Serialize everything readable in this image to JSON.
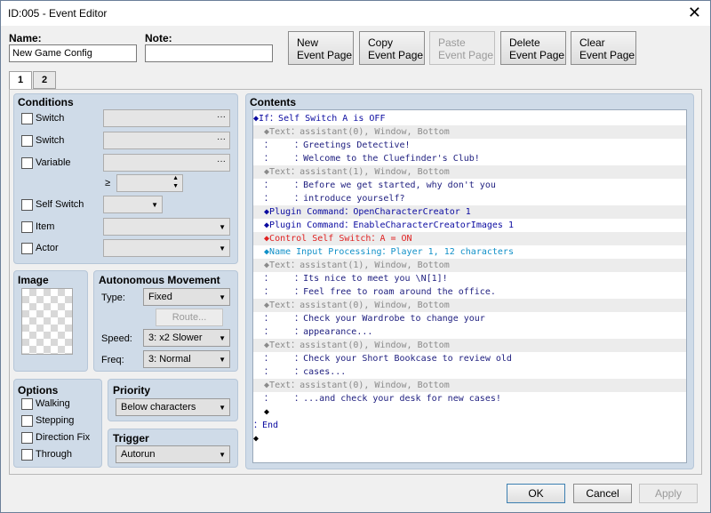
{
  "window": {
    "title": "ID:005 - Event Editor",
    "close": "✕"
  },
  "name_label": "Name:",
  "name_value": "New Game Config",
  "note_label": "Note:",
  "note_value": "",
  "page_buttons": {
    "new": [
      "New",
      "Event Page"
    ],
    "copy": [
      "Copy",
      "Event Page"
    ],
    "paste": [
      "Paste",
      "Event Page"
    ],
    "delete": [
      "Delete",
      "Event Page"
    ],
    "clear": [
      "Clear",
      "Event Page"
    ]
  },
  "tabs": [
    "1",
    "2"
  ],
  "conditions": {
    "title": "Conditions",
    "switch1": "Switch",
    "switch2": "Switch",
    "variable": "Variable",
    "ge": "≥",
    "self_switch": "Self Switch",
    "item": "Item",
    "actor": "Actor",
    "dots": "···"
  },
  "image": {
    "title": "Image"
  },
  "autonomous": {
    "title": "Autonomous Movement",
    "type_label": "Type:",
    "type_value": "Fixed",
    "route_button": "Route...",
    "speed_label": "Speed:",
    "speed_value": "3: x2 Slower",
    "freq_label": "Freq:",
    "freq_value": "3: Normal"
  },
  "options": {
    "title": "Options",
    "walking": "Walking",
    "stepping": "Stepping",
    "direction_fix": "Direction Fix",
    "through": "Through"
  },
  "priority": {
    "title": "Priority",
    "value": "Below characters"
  },
  "trigger": {
    "title": "Trigger",
    "value": "Autorun"
  },
  "contents": {
    "title": "Contents",
    "lines": [
      "◆If：Self Switch A is OFF",
      "  ◆Text：assistant(0), Window, Bottom",
      "  ：    ：Greetings Detective!",
      "  ：    ：Welcome to the Cluefinder's Club!",
      "  ◆Text：assistant(1), Window, Bottom",
      "  ：    ：Before we get started, why don't you",
      "  ：    ：introduce yourself?",
      "  ◆Plugin Command：OpenCharacterCreator 1",
      "  ◆Plugin Command：EnableCharacterCreatorImages 1",
      "  ◆Control Self Switch：A = ON",
      "  ◆Name Input Processing：Player 1, 12 characters",
      "  ◆Text：assistant(1), Window, Bottom",
      "  ：    ：Its nice to meet you \\N[1]!",
      "  ：    ：Feel free to roam around the office.",
      "  ◆Text：assistant(0), Window, Bottom",
      "  ：    ：Check your Wardrobe to change your",
      "  ：    ：appearance...",
      "  ◆Text：assistant(0), Window, Bottom",
      "  ：    ：Check your Short Bookcase to review old",
      "  ：    ：cases...",
      "  ◆Text：assistant(0), Window, Bottom",
      "  ：    ：...and check your desk for new cases!",
      "  ◆",
      "：End",
      "◆"
    ]
  },
  "footer": {
    "ok": "OK",
    "cancel": "Cancel",
    "apply": "Apply"
  }
}
